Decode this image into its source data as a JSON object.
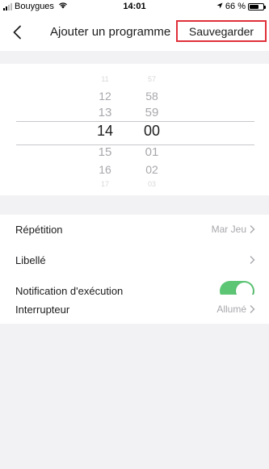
{
  "status_bar": {
    "carrier": "Bouygues",
    "time": "14:01",
    "battery_text": "66 %",
    "battery_level": 0.66,
    "icons": [
      "signal-icon",
      "wifi-icon",
      "location-arrow-icon",
      "battery-icon"
    ]
  },
  "nav": {
    "back_icon": "chevron-left-icon",
    "title": "Ajouter un programme",
    "save_label": "Sauvegarder",
    "save_highlight_color": "#e0303a"
  },
  "picker": {
    "hours": [
      "11",
      "12",
      "13",
      "14",
      "15",
      "16",
      "17"
    ],
    "minutes": [
      "57",
      "58",
      "59",
      "00",
      "01",
      "02",
      "03"
    ],
    "selected_hour": "14",
    "selected_minute": "00"
  },
  "settings": {
    "repetition_label": "Répétition",
    "repetition_value": "Mar Jeu",
    "libelle_label": "Libellé",
    "notification_label": "Notification d'exécution",
    "notification_enabled": true,
    "toggle_color": "#5cc675",
    "interrupteur_label": "Interrupteur",
    "interrupteur_value": "Allumé"
  }
}
